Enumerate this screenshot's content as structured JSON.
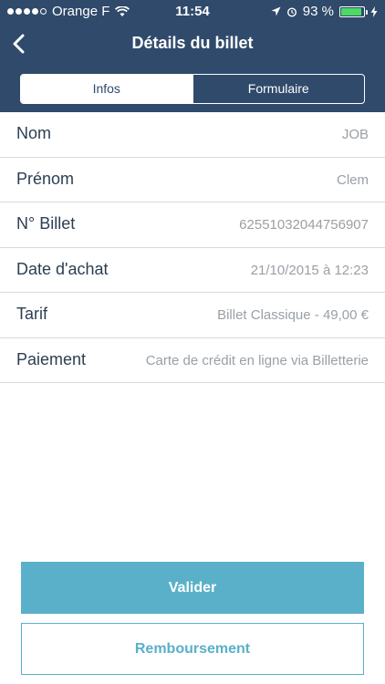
{
  "status_bar": {
    "carrier": "Orange F",
    "time": "11:54",
    "battery_percent": "93 %",
    "battery_level": 0.93,
    "colors": {
      "battery": "#4cd964"
    }
  },
  "nav": {
    "title": "Détails du billet",
    "back_icon": "chevron-left-icon"
  },
  "tabs": [
    {
      "label": "Infos",
      "active": true
    },
    {
      "label": "Formulaire",
      "active": false
    }
  ],
  "details": {
    "rows": [
      {
        "label": "Nom",
        "value": "JOB"
      },
      {
        "label": "Prénom",
        "value": "Clem"
      },
      {
        "label": "N° Billet",
        "value": "62551032044756907"
      },
      {
        "label": "Date d'achat",
        "value": "21/10/2015 à 12:23"
      },
      {
        "label": "Tarif",
        "value": "Billet Classique - 49,00 €"
      },
      {
        "label": "Paiement",
        "value": "Carte de crédit en ligne via Billetterie"
      }
    ]
  },
  "actions": {
    "validate_label": "Valider",
    "refund_label": "Remboursement"
  },
  "colors": {
    "header": "#2f4a6b",
    "accent": "#5ab0c9",
    "label_text": "#2c3e50",
    "value_text": "#9aa0a6"
  }
}
